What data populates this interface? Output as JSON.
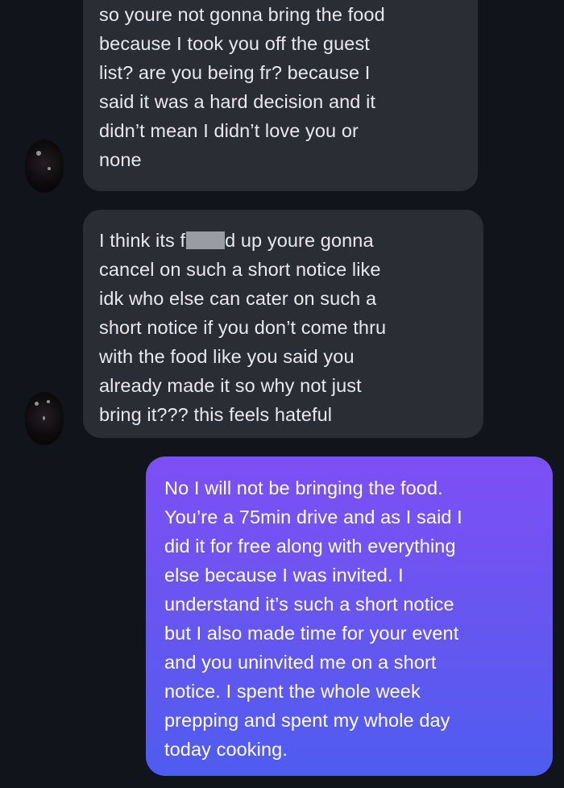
{
  "conversation": {
    "messages": [
      {
        "direction": "incoming",
        "text": "so youre not gonna bring the food\nbecause I took you off the guest\nlist? are you being fr? because I\nsaid it was a hard decision and it\ndidn’t mean I didn’t love you or\nnone"
      },
      {
        "direction": "incoming",
        "text_before_redaction": "I think its f",
        "text_after_redaction": "d up youre gonna\ncancel on such a short notice like\nidk who else can cater on such a\nshort notice if you don’t come thru\nwith the food like you said you\nalready made it so why not just\nbring it??? this feels hateful"
      },
      {
        "direction": "outgoing",
        "text": "No I will not be bringing the food.\nYou’re a 75min drive and as I said I\ndid it for free along with everything\nelse because I was invited. I\nunderstand it’s such a short notice\nbut I also made time for your event\nand you uninvited me on a short\nnotice. I spent the whole week\nprepping and spent my whole day\ntoday cooking."
      }
    ]
  },
  "colors": {
    "background": "#12141b",
    "incoming_bubble": "#2b2d35",
    "outgoing_gradient_top": "#7d4ff5",
    "outgoing_gradient_bottom": "#4f5cef"
  },
  "icons": {
    "sender_avatar": "avatar-icon",
    "redaction": "censor-bar"
  }
}
